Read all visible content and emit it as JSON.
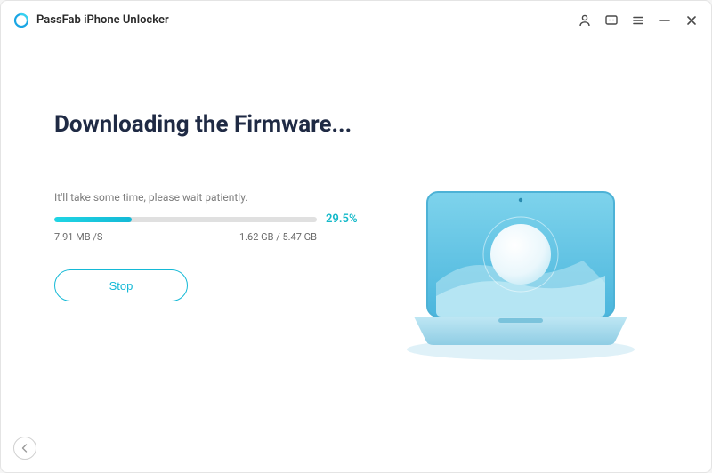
{
  "app": {
    "title": "PassFab iPhone Unlocker"
  },
  "main": {
    "heading": "Downloading the Firmware...",
    "wait_text": "It'll take some time, please wait patiently.",
    "progress_pct": "29.5%",
    "progress_value": 29.5,
    "speed": "7.91 MB /S",
    "size_status": "1.62 GB / 5.47 GB",
    "stop_label": "Stop"
  },
  "colors": {
    "accent": "#14b9d6"
  }
}
